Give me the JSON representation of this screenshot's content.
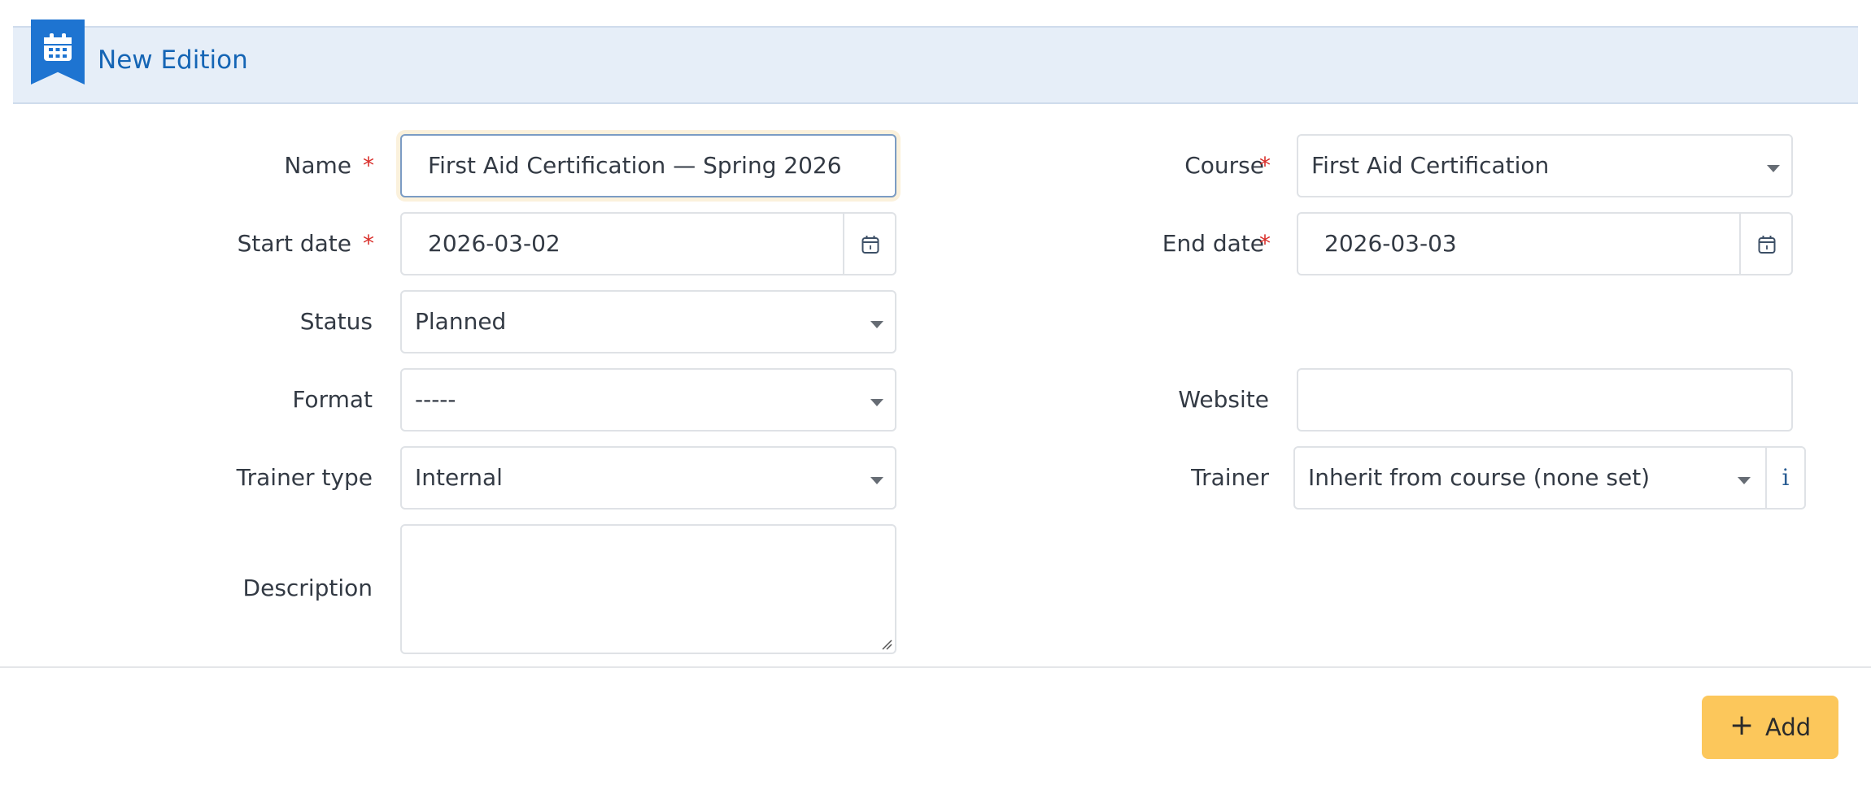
{
  "header": {
    "title": "New Edition",
    "icon": "calendar-icon"
  },
  "form": {
    "name": {
      "label": "Name",
      "required": "*",
      "value": "First Aid Certification — Spring 2026"
    },
    "course": {
      "label": "Course",
      "required": "*",
      "value": "First Aid Certification"
    },
    "start_date": {
      "label": "Start date",
      "required": "*",
      "value": "2026-03-02"
    },
    "end_date": {
      "label": "End date",
      "required": "*",
      "value": "2026-03-03"
    },
    "status": {
      "label": "Status",
      "value": "Planned"
    },
    "format": {
      "label": "Format",
      "value": "-----"
    },
    "website": {
      "label": "Website",
      "value": ""
    },
    "trainer_type": {
      "label": "Trainer type",
      "value": "Internal"
    },
    "trainer": {
      "label": "Trainer",
      "value": "Inherit from course (none set)",
      "info_glyph": "i"
    },
    "description": {
      "label": "Description",
      "value": ""
    }
  },
  "actions": {
    "add_label": "Add",
    "add_icon": "plus-icon"
  },
  "colors": {
    "accent": "#1e74d1",
    "title": "#1565b5",
    "header_bg": "#e6eef8",
    "required": "#d9302c",
    "add_button": "#fcc75b"
  }
}
